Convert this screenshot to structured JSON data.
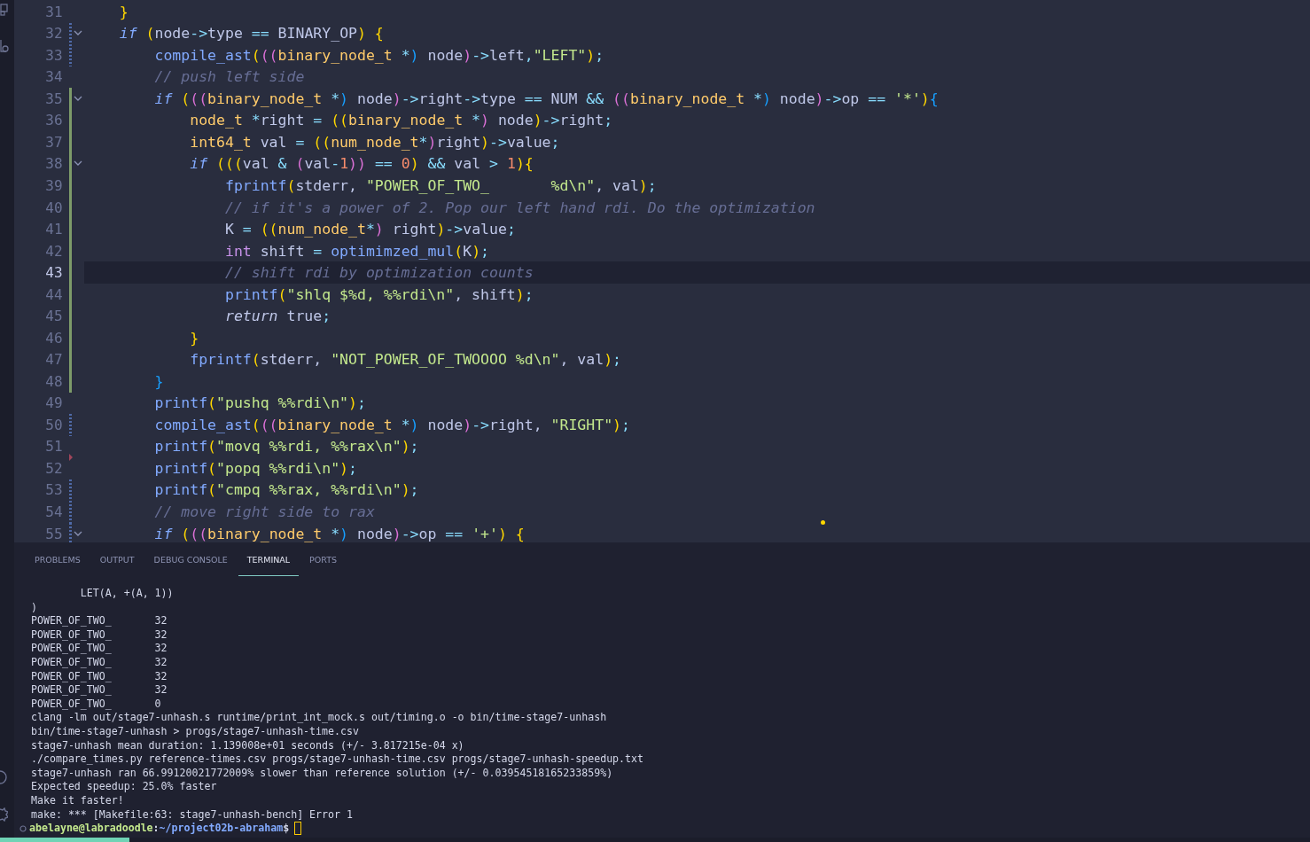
{
  "editor": {
    "lines": [
      {
        "number": "31",
        "current": false,
        "foldable": false,
        "added": false,
        "modified": false,
        "deleted": false,
        "tokens": [
          {
            "kind": "br",
            "text": "    }"
          }
        ]
      },
      {
        "number": "32",
        "current": false,
        "foldable": true,
        "added": false,
        "modified": true,
        "deleted": false,
        "tokens": [
          {
            "kind": "kw",
            "text": "    if "
          },
          {
            "kind": "br",
            "text": "("
          },
          {
            "kind": "tx",
            "text": "node"
          },
          {
            "kind": "op",
            "text": "->"
          },
          {
            "kind": "tx",
            "text": "type "
          },
          {
            "kind": "op",
            "text": "=="
          },
          {
            "kind": "tx",
            "text": " BINARY_OP"
          },
          {
            "kind": "br",
            "text": ") {"
          }
        ]
      },
      {
        "number": "33",
        "current": false,
        "foldable": false,
        "added": false,
        "modified": true,
        "deleted": false,
        "tokens": [
          {
            "kind": "fn",
            "text": "        compile_ast"
          },
          {
            "kind": "br",
            "text": "("
          },
          {
            "kind": "br2",
            "text": "(("
          },
          {
            "kind": "ty",
            "text": "binary_node_t"
          },
          {
            "kind": "op",
            "text": " *"
          },
          {
            "kind": "br3",
            "text": ")"
          },
          {
            "kind": "tx",
            "text": " node"
          },
          {
            "kind": "br2",
            "text": ")"
          },
          {
            "kind": "op",
            "text": "->"
          },
          {
            "kind": "tx",
            "text": "left"
          },
          {
            "kind": "op",
            "text": ","
          },
          {
            "kind": "str",
            "text": "\"LEFT\""
          },
          {
            "kind": "br",
            "text": ")"
          },
          {
            "kind": "op",
            "text": ";"
          }
        ]
      },
      {
        "number": "34",
        "current": false,
        "foldable": false,
        "added": false,
        "modified": false,
        "deleted": false,
        "tokens": [
          {
            "kind": "cm",
            "text": "        // push left side"
          }
        ]
      },
      {
        "number": "35",
        "current": false,
        "foldable": true,
        "added": true,
        "modified": false,
        "deleted": false,
        "tokens": [
          {
            "kind": "kw",
            "text": "        if "
          },
          {
            "kind": "br",
            "text": "("
          },
          {
            "kind": "br2",
            "text": "(("
          },
          {
            "kind": "ty",
            "text": "binary_node_t"
          },
          {
            "kind": "op",
            "text": " *"
          },
          {
            "kind": "br3",
            "text": ")"
          },
          {
            "kind": "tx",
            "text": " node"
          },
          {
            "kind": "br2",
            "text": ")"
          },
          {
            "kind": "op",
            "text": "->"
          },
          {
            "kind": "tx",
            "text": "right"
          },
          {
            "kind": "op",
            "text": "->"
          },
          {
            "kind": "tx",
            "text": "type "
          },
          {
            "kind": "op",
            "text": "=="
          },
          {
            "kind": "tx",
            "text": " NUM "
          },
          {
            "kind": "op",
            "text": "&&"
          },
          {
            "kind": "br2",
            "text": " (("
          },
          {
            "kind": "ty",
            "text": "binary_node_t"
          },
          {
            "kind": "op",
            "text": " *"
          },
          {
            "kind": "br3",
            "text": ")"
          },
          {
            "kind": "tx",
            "text": " node"
          },
          {
            "kind": "br2",
            "text": ")"
          },
          {
            "kind": "op",
            "text": "->"
          },
          {
            "kind": "tx",
            "text": "op "
          },
          {
            "kind": "op",
            "text": "=="
          },
          {
            "kind": "str",
            "text": " '*'"
          },
          {
            "kind": "br",
            "text": ")"
          },
          {
            "kind": "br3",
            "text": "{"
          }
        ]
      },
      {
        "number": "36",
        "current": false,
        "foldable": false,
        "added": true,
        "modified": false,
        "deleted": false,
        "tokens": [
          {
            "kind": "ty",
            "text": "            node_t"
          },
          {
            "kind": "op",
            "text": " *"
          },
          {
            "kind": "tx",
            "text": "right "
          },
          {
            "kind": "op",
            "text": "="
          },
          {
            "kind": "br",
            "text": " (("
          },
          {
            "kind": "ty",
            "text": "binary_node_t"
          },
          {
            "kind": "op",
            "text": " *"
          },
          {
            "kind": "br2",
            "text": ")"
          },
          {
            "kind": "tx",
            "text": " node"
          },
          {
            "kind": "br",
            "text": ")"
          },
          {
            "kind": "op",
            "text": "->"
          },
          {
            "kind": "tx",
            "text": "right"
          },
          {
            "kind": "op",
            "text": ";"
          }
        ]
      },
      {
        "number": "37",
        "current": false,
        "foldable": false,
        "added": true,
        "modified": false,
        "deleted": false,
        "tokens": [
          {
            "kind": "ty",
            "text": "            int64_t"
          },
          {
            "kind": "tx",
            "text": " val "
          },
          {
            "kind": "op",
            "text": "="
          },
          {
            "kind": "br",
            "text": " (("
          },
          {
            "kind": "ty",
            "text": "num_node_t"
          },
          {
            "kind": "op",
            "text": "*"
          },
          {
            "kind": "br2",
            "text": ")"
          },
          {
            "kind": "tx",
            "text": "right"
          },
          {
            "kind": "br",
            "text": ")"
          },
          {
            "kind": "op",
            "text": "->"
          },
          {
            "kind": "tx",
            "text": "value"
          },
          {
            "kind": "op",
            "text": ";"
          }
        ]
      },
      {
        "number": "38",
        "current": false,
        "foldable": true,
        "added": true,
        "modified": false,
        "deleted": false,
        "tokens": [
          {
            "kind": "kw",
            "text": "            if "
          },
          {
            "kind": "br",
            "text": "((("
          },
          {
            "kind": "tx",
            "text": "val "
          },
          {
            "kind": "op",
            "text": "&"
          },
          {
            "kind": "br2",
            "text": " ("
          },
          {
            "kind": "tx",
            "text": "val"
          },
          {
            "kind": "op",
            "text": "-"
          },
          {
            "kind": "nu",
            "text": "1"
          },
          {
            "kind": "br2",
            "text": "))"
          },
          {
            "kind": "op",
            "text": " =="
          },
          {
            "kind": "nu",
            "text": " 0"
          },
          {
            "kind": "br",
            "text": ")"
          },
          {
            "kind": "op",
            "text": " &&"
          },
          {
            "kind": "tx",
            "text": " val "
          },
          {
            "kind": "op",
            "text": ">"
          },
          {
            "kind": "nu",
            "text": " 1"
          },
          {
            "kind": "br",
            "text": "){"
          }
        ]
      },
      {
        "number": "39",
        "current": false,
        "foldable": false,
        "added": true,
        "modified": false,
        "deleted": false,
        "tokens": [
          {
            "kind": "fn",
            "text": "                fprintf"
          },
          {
            "kind": "br",
            "text": "("
          },
          {
            "kind": "tx",
            "text": "stderr, "
          },
          {
            "kind": "str",
            "text": "\"POWER_OF_TWO_       %d\\n\""
          },
          {
            "kind": "tx",
            "text": ", val"
          },
          {
            "kind": "br",
            "text": ")"
          },
          {
            "kind": "op",
            "text": ";"
          }
        ]
      },
      {
        "number": "40",
        "current": false,
        "foldable": false,
        "added": true,
        "modified": false,
        "deleted": false,
        "tokens": [
          {
            "kind": "cm",
            "text": "                // if it's a power of 2. Pop our left hand rdi. Do the optimization"
          }
        ]
      },
      {
        "number": "41",
        "current": false,
        "foldable": false,
        "added": true,
        "modified": false,
        "deleted": false,
        "tokens": [
          {
            "kind": "tx",
            "text": "                K "
          },
          {
            "kind": "op",
            "text": "="
          },
          {
            "kind": "br",
            "text": " (("
          },
          {
            "kind": "ty",
            "text": "num_node_t"
          },
          {
            "kind": "op",
            "text": "*"
          },
          {
            "kind": "br2",
            "text": ")"
          },
          {
            "kind": "tx",
            "text": " right"
          },
          {
            "kind": "br",
            "text": ")"
          },
          {
            "kind": "op",
            "text": "->"
          },
          {
            "kind": "tx",
            "text": "value"
          },
          {
            "kind": "op",
            "text": ";"
          }
        ]
      },
      {
        "number": "42",
        "current": false,
        "foldable": false,
        "added": true,
        "modified": false,
        "deleted": false,
        "tokens": [
          {
            "kind": "kwp",
            "text": "                int"
          },
          {
            "kind": "tx",
            "text": " shift "
          },
          {
            "kind": "op",
            "text": "="
          },
          {
            "kind": "fn",
            "text": " optimimzed_mul"
          },
          {
            "kind": "br",
            "text": "("
          },
          {
            "kind": "tx",
            "text": "K"
          },
          {
            "kind": "br",
            "text": ")"
          },
          {
            "kind": "op",
            "text": ";"
          }
        ]
      },
      {
        "number": "43",
        "current": true,
        "foldable": false,
        "added": true,
        "modified": false,
        "deleted": false,
        "tokens": [
          {
            "kind": "cm",
            "text": "                // shift rdi by optimization counts"
          }
        ]
      },
      {
        "number": "44",
        "current": false,
        "foldable": false,
        "added": true,
        "modified": false,
        "deleted": false,
        "tokens": [
          {
            "kind": "fn",
            "text": "                printf"
          },
          {
            "kind": "br",
            "text": "("
          },
          {
            "kind": "str",
            "text": "\"shlq $%d, %%rdi\\n\""
          },
          {
            "kind": "tx",
            "text": ", shift"
          },
          {
            "kind": "br",
            "text": ")"
          },
          {
            "kind": "op",
            "text": ";"
          }
        ]
      },
      {
        "number": "45",
        "current": false,
        "foldable": false,
        "added": true,
        "modified": false,
        "deleted": false,
        "tokens": [
          {
            "kind": "kwr",
            "text": "                return"
          },
          {
            "kind": "tx",
            "text": " true"
          },
          {
            "kind": "op",
            "text": ";"
          }
        ]
      },
      {
        "number": "46",
        "current": false,
        "foldable": false,
        "added": true,
        "modified": false,
        "deleted": false,
        "tokens": [
          {
            "kind": "br",
            "text": "            }"
          }
        ]
      },
      {
        "number": "47",
        "current": false,
        "foldable": false,
        "added": true,
        "modified": false,
        "deleted": false,
        "tokens": [
          {
            "kind": "fn",
            "text": "            fprintf"
          },
          {
            "kind": "br",
            "text": "("
          },
          {
            "kind": "tx",
            "text": "stderr, "
          },
          {
            "kind": "str",
            "text": "\"NOT_POWER_OF_TWOOOO %d\\n\""
          },
          {
            "kind": "tx",
            "text": ", val"
          },
          {
            "kind": "br",
            "text": ")"
          },
          {
            "kind": "op",
            "text": ";"
          }
        ]
      },
      {
        "number": "48",
        "current": false,
        "foldable": false,
        "added": true,
        "modified": false,
        "deleted": false,
        "tokens": [
          {
            "kind": "br3",
            "text": "        }"
          }
        ]
      },
      {
        "number": "49",
        "current": false,
        "foldable": false,
        "added": false,
        "modified": false,
        "deleted": false,
        "tokens": [
          {
            "kind": "fn",
            "text": "        printf"
          },
          {
            "kind": "br",
            "text": "("
          },
          {
            "kind": "str",
            "text": "\"pushq %%rdi\\n\""
          },
          {
            "kind": "br",
            "text": ")"
          },
          {
            "kind": "op",
            "text": ";"
          }
        ]
      },
      {
        "number": "50",
        "current": false,
        "foldable": false,
        "added": false,
        "modified": true,
        "deleted": false,
        "tokens": [
          {
            "kind": "fn",
            "text": "        compile_ast"
          },
          {
            "kind": "br",
            "text": "("
          },
          {
            "kind": "br2",
            "text": "(("
          },
          {
            "kind": "ty",
            "text": "binary_node_t"
          },
          {
            "kind": "op",
            "text": " *"
          },
          {
            "kind": "br3",
            "text": ")"
          },
          {
            "kind": "tx",
            "text": " node"
          },
          {
            "kind": "br2",
            "text": ")"
          },
          {
            "kind": "op",
            "text": "->"
          },
          {
            "kind": "tx",
            "text": "right, "
          },
          {
            "kind": "str",
            "text": "\"RIGHT\""
          },
          {
            "kind": "br",
            "text": ")"
          },
          {
            "kind": "op",
            "text": ";"
          }
        ]
      },
      {
        "number": "51",
        "current": false,
        "foldable": false,
        "added": false,
        "modified": false,
        "deleted": false,
        "tokens": [
          {
            "kind": "fn",
            "text": "        printf"
          },
          {
            "kind": "br",
            "text": "("
          },
          {
            "kind": "str",
            "text": "\"movq %%rdi, %%rax\\n\""
          },
          {
            "kind": "br",
            "text": ")"
          },
          {
            "kind": "op",
            "text": ";"
          }
        ]
      },
      {
        "number": "52",
        "current": false,
        "foldable": false,
        "added": false,
        "modified": false,
        "deleted": true,
        "tokens": [
          {
            "kind": "fn",
            "text": "        printf"
          },
          {
            "kind": "br",
            "text": "("
          },
          {
            "kind": "str",
            "text": "\"popq %%rdi\\n\""
          },
          {
            "kind": "br",
            "text": ")"
          },
          {
            "kind": "op",
            "text": ";"
          }
        ]
      },
      {
        "number": "53",
        "current": false,
        "foldable": false,
        "added": false,
        "modified": true,
        "deleted": false,
        "tokens": [
          {
            "kind": "fn",
            "text": "        printf"
          },
          {
            "kind": "br",
            "text": "("
          },
          {
            "kind": "str",
            "text": "\"cmpq %%rax, %%rdi\\n\""
          },
          {
            "kind": "br",
            "text": ")"
          },
          {
            "kind": "op",
            "text": ";"
          }
        ]
      },
      {
        "number": "54",
        "current": false,
        "foldable": false,
        "added": false,
        "modified": true,
        "deleted": false,
        "tokens": [
          {
            "kind": "cm",
            "text": "        // move right side to rax"
          }
        ]
      },
      {
        "number": "55",
        "current": false,
        "foldable": true,
        "added": false,
        "modified": true,
        "deleted": false,
        "tokens": [
          {
            "kind": "kw",
            "text": "        if "
          },
          {
            "kind": "br",
            "text": "("
          },
          {
            "kind": "br2",
            "text": "(("
          },
          {
            "kind": "ty",
            "text": "binary_node_t"
          },
          {
            "kind": "op",
            "text": " *"
          },
          {
            "kind": "br3",
            "text": ")"
          },
          {
            "kind": "tx",
            "text": " node"
          },
          {
            "kind": "br2",
            "text": ")"
          },
          {
            "kind": "op",
            "text": "->"
          },
          {
            "kind": "tx",
            "text": "op "
          },
          {
            "kind": "op",
            "text": "=="
          },
          {
            "kind": "str",
            "text": " '+'"
          },
          {
            "kind": "br",
            "text": ") {"
          }
        ]
      }
    ]
  },
  "panel": {
    "tabs": [
      {
        "label": "PROBLEMS",
        "selected": false
      },
      {
        "label": "OUTPUT",
        "selected": false
      },
      {
        "label": "DEBUG CONSOLE",
        "selected": false
      },
      {
        "label": "TERMINAL",
        "selected": true
      },
      {
        "label": "PORTS",
        "selected": false
      }
    ],
    "terminal": {
      "lines": [
        "        LET(A, +(A, 1))",
        ")",
        "POWER_OF_TWO_       32",
        "POWER_OF_TWO_       32",
        "POWER_OF_TWO_       32",
        "POWER_OF_TWO_       32",
        "POWER_OF_TWO_       32",
        "POWER_OF_TWO_       32",
        "POWER_OF_TWO_       0",
        "clang -lm out/stage7-unhash.s runtime/print_int_mock.s out/timing.o -o bin/time-stage7-unhash",
        "bin/time-stage7-unhash > progs/stage7-unhash-time.csv",
        "stage7-unhash mean duration: 1.139008e+01 seconds (+/- 3.817215e-04 x)",
        "./compare_times.py reference-times.csv progs/stage7-unhash-time.csv progs/stage7-unhash-speedup.txt",
        "stage7-unhash ran 66.99120021772009% slower than reference solution (+/- 0.03954518165233859%)",
        "Expected speedup: 25.0% faster",
        "Make it faster!",
        "make: *** [Makefile:63: stage7-unhash-bench] Error 1"
      ],
      "prompt": {
        "user": "abelayne@labradoodle",
        "separator": ":",
        "path": "~/project02b-abraham",
        "symbol": "$"
      }
    }
  }
}
